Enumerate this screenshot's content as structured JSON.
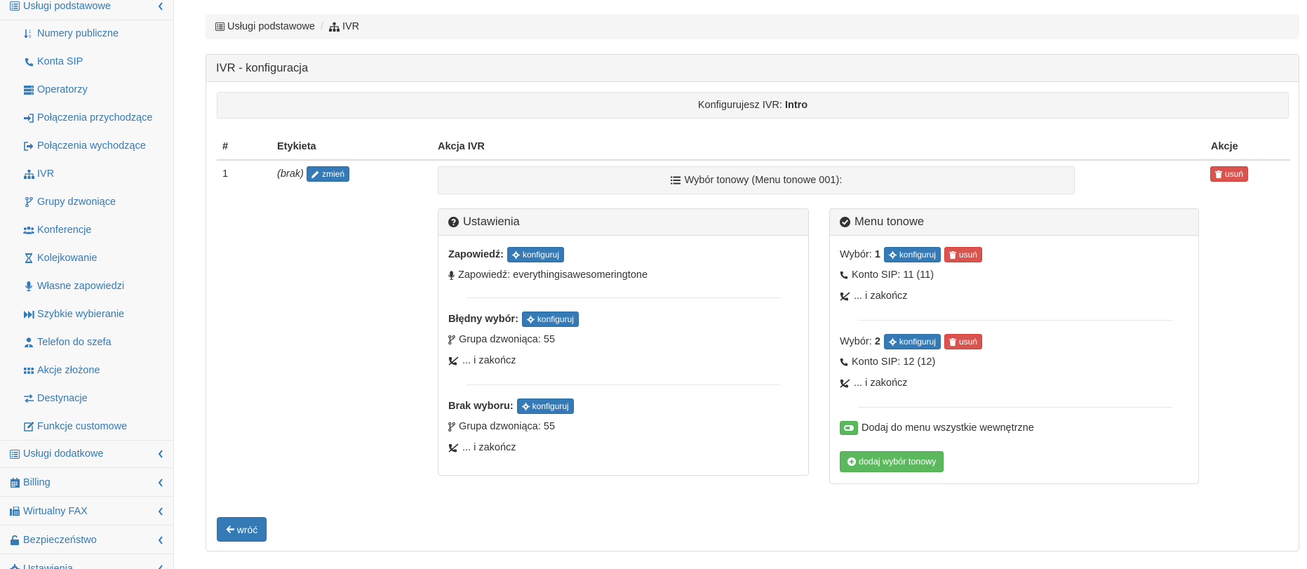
{
  "sidebar": {
    "top_group": "Usługi podstawowe",
    "items": [
      {
        "label": "Numery publiczne",
        "icon": "sort-numeric-icon"
      },
      {
        "label": "Konta SIP",
        "icon": "phone-icon"
      },
      {
        "label": "Operatorzy",
        "icon": "server-icon"
      },
      {
        "label": "Połączenia przychodzące",
        "icon": "sign-in-icon"
      },
      {
        "label": "Połączenia wychodzące",
        "icon": "sign-out-icon"
      },
      {
        "label": "IVR",
        "icon": "sitemap-icon"
      },
      {
        "label": "Grupy dzwoniące",
        "icon": "code-fork-icon"
      },
      {
        "label": "Konferencje",
        "icon": "users-icon"
      },
      {
        "label": "Kolejkowanie",
        "icon": "hourglass-icon"
      },
      {
        "label": "Własne zapowiedzi",
        "icon": "microphone-icon"
      },
      {
        "label": "Szybkie wybieranie",
        "icon": "fast-forward-icon"
      },
      {
        "label": "Telefon do szefa",
        "icon": "user-tie-icon"
      },
      {
        "label": "Akcje złożone",
        "icon": "th-icon"
      },
      {
        "label": "Destynacje",
        "icon": "exchange-icon"
      },
      {
        "label": "Funkcje customowe",
        "icon": "edit-icon"
      }
    ],
    "groups": [
      {
        "label": "Usługi dodatkowe",
        "icon": "list-alt-icon"
      },
      {
        "label": "Billing",
        "icon": "calendar-icon"
      },
      {
        "label": "Wirtualny FAX",
        "icon": "fax-icon"
      },
      {
        "label": "Bezpieczeństwo",
        "icon": "unlock-icon"
      },
      {
        "label": "Ustawienia",
        "icon": "cog-icon"
      }
    ]
  },
  "breadcrumb": {
    "item1": "Usługi podstawowe",
    "separator": "/",
    "item2": "IVR"
  },
  "panel": {
    "title": "IVR - konfiguracja",
    "info_prefix": "Konfigurujesz IVR:",
    "info_name": "Intro"
  },
  "table": {
    "headers": {
      "num": "#",
      "label": "Etykieta",
      "action": "Akcja IVR",
      "actions": "Akcje"
    },
    "row": {
      "num": "1",
      "label": "(brak)",
      "change_button": "zmień",
      "delete_button": "usuń",
      "action_title": "Wybór tonowy (Menu tonowe 001):"
    }
  },
  "settings": {
    "title": "Ustawienia",
    "configure_label": "konfiguruj",
    "announcement_label": "Zapowiedź:",
    "announcement_value": "Zapowiedź: everythingisawesomeringtone",
    "wrong_choice_label": "Błędny wybór:",
    "wrong_choice_target": "Grupa dzwoniąca: 55",
    "wrong_choice_end": "... i zakończ",
    "no_choice_label": "Brak wyboru:",
    "no_choice_target": "Grupa dzwoniąca: 55",
    "no_choice_end": "... i zakończ"
  },
  "tone_menu": {
    "title": "Menu tonowe",
    "choice_label": "Wybór:",
    "configure_label": "konfiguruj",
    "delete_label": "usuń",
    "choices": [
      {
        "digit": "1",
        "target": "Konto SIP: 11 (11)",
        "end": "... i zakończ"
      },
      {
        "digit": "2",
        "target": "Konto SIP: 12 (12)",
        "end": "... i zakończ"
      }
    ],
    "add_all_internal": "Dodaj do menu wszystkie wewnętrzne",
    "add_button": "dodaj wybór tonowy"
  },
  "back_button": "wróć",
  "colors": {
    "primary": "#337ab7",
    "danger": "#d9534f",
    "success": "#5cb85c"
  }
}
